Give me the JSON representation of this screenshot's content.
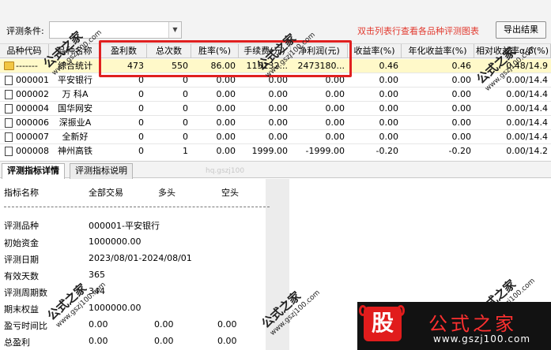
{
  "toolbar": {
    "condition_label": "评测条件:",
    "condition_value": "",
    "hint": "双击列表行查看各品种评测图表",
    "export_label": "导出结果"
  },
  "grid": {
    "columns": [
      "品种代码",
      "品种名称",
      "盈利数",
      "总次数",
      "胜率(%)",
      "手续费(元)",
      "净利润(元)",
      "收益率(%)",
      "年化收益率(%)",
      "相对收益率α/β(%)"
    ],
    "summary_row": [
      "-------",
      "综合统计",
      "473",
      "550",
      "86.00",
      "115132...",
      "2473180...",
      "0.46",
      "0.46",
      "0.48/14.9"
    ],
    "rows": [
      [
        "000001",
        "平安银行",
        "0",
        "0",
        "0.00",
        "0.00",
        "0.00",
        "0.00",
        "0.00",
        "0.00/14.4"
      ],
      [
        "000002",
        "万 科A",
        "0",
        "0",
        "0.00",
        "0.00",
        "0.00",
        "0.00",
        "0.00",
        "0.00/14.4"
      ],
      [
        "000004",
        "国华网安",
        "0",
        "0",
        "0.00",
        "0.00",
        "0.00",
        "0.00",
        "0.00",
        "0.00/14.4"
      ],
      [
        "000006",
        "深振业A",
        "0",
        "0",
        "0.00",
        "0.00",
        "0.00",
        "0.00",
        "0.00",
        "0.00/14.4"
      ],
      [
        "000007",
        "全新好",
        "0",
        "0",
        "0.00",
        "0.00",
        "0.00",
        "0.00",
        "0.00",
        "0.00/14.4"
      ],
      [
        "000008",
        "神州高铁",
        "0",
        "1",
        "0.00",
        "1999.00",
        "-1999.00",
        "-0.20",
        "-0.20",
        "0.00/14.2"
      ]
    ]
  },
  "tabs": [
    "评测指标详情",
    "评测指标说明"
  ],
  "details": {
    "headers": [
      "指标名称",
      "全部交易",
      "多头",
      "空头"
    ],
    "items": [
      {
        "label": "评测品种",
        "all": "000001-平安银行",
        "long": "",
        "short": ""
      },
      {
        "label": "初始资金",
        "all": "1000000.00",
        "long": "",
        "short": ""
      },
      {
        "label": "评测日期",
        "all": "2023/08/01-2024/08/01",
        "long": "",
        "short": ""
      },
      {
        "label": "有效天数",
        "all": "365",
        "long": "",
        "short": ""
      },
      {
        "label": "评测周期数",
        "all": "344",
        "long": "",
        "short": ""
      },
      {
        "label": "期末权益",
        "all": "1000000.00",
        "long": "",
        "short": ""
      },
      {
        "label": "盈亏时间比",
        "all": "0.00",
        "long": "0.00",
        "short": "0.00"
      },
      {
        "label": "总盈利",
        "all": "0.00",
        "long": "0.00",
        "short": "0.00"
      }
    ]
  },
  "watermark": {
    "title": "公式之家",
    "url": "www.gszj100.com",
    "faint": "hq.gszj100"
  },
  "logo": {
    "badge": "股",
    "title": "公式之家",
    "url": "www.gszj100.com"
  },
  "colors": {
    "hint": "#e23a2f",
    "highlight": "#e02020",
    "selected_row": "#fff9c9",
    "logo_red": "#e11c1c"
  }
}
